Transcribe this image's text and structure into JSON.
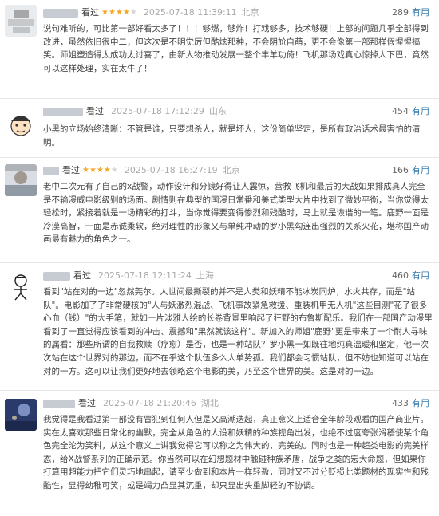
{
  "comments": [
    {
      "action": "看过",
      "rating": 4,
      "time": "2025-07-18 11:39:11",
      "location": "北京",
      "votes": "289",
      "useful_label": "有用",
      "content": "说句难听的，可比第一部好看太多了！！！够燃，够炸！打戏够多，技术够硬！上部的问题几乎全部得到改进，虽然依旧很中二，但这次是不明觉厉但酷炫那种，不会阴尬自萌，更不会像第一部那样假惺惺搞笑。师姐塑造得太成功太讨喜了，由新人物推动发展一整个丰羊功倚！飞机那场戏真心惊掉人下巴，竟然可以这样处理，实在太牛了！"
    },
    {
      "action": "看过",
      "rating": 0,
      "time": "2025-07-18 17:12:29",
      "location": "山东",
      "votes": "454",
      "useful_label": "有用",
      "content": "小黑的立场始终清晰：不管是谁，只要想杀人，就是坏人，这份简单坚定，是所有政治话术最害怕的清明。"
    },
    {
      "action": "看过",
      "rating": 4,
      "time": "2025-07-18 16:27:19",
      "location": "北京",
      "votes": "166",
      "useful_label": "有用",
      "content": "老中二次元有了自己的x战警，动作设计和分镜好得让人震惊，营救飞机和最后的大战如果排成真人完全是不输漫威电影级别的场面。剧情则在典型的国漫日常番和美式类型大片中找到了微妙平衡，当你觉得太轻松时，紧接着就是一场精彩的打斗，当你觉得要变得惨烈和残酷时，马上就是诙谐的一笔。鹿野一面是冷漠高智，一面是赤诚柔软，绝对理性的形象又与单纯冲动的罗小黑勾连出强烈的关系火花，堪称国产动画最有魅力的角色之一。"
    },
    {
      "action": "看过",
      "rating": 0,
      "time": "2025-07-18 12:11:24",
      "location": "上海",
      "votes": "460",
      "useful_label": "有用",
      "content": "看到\"站在对的一边\"忽然莞尔。人世间最撕裂的并不是人类和妖精不能冰炭同炉，水火共存，而是\"站队\"。电影加了了非常硬核的\"人与妖激烈混战、飞机事故紧急救援、重装机甲无人机\"这些目测\"花了很多心血（钱）\"的大手笔，就如一片淡雅人绘的长卷背景里响起了狂野的布鲁斯配乐。我们在一部国产动漫里看到了一直觉得应该看到的冲击、震撼和\"果然就该这样\"。新加入的师姐\"鹿野\"更是带来了一个耐人寻味的属看：那些所谓的自我救赎（疗愈）是否，也是一种站队？罗小黑一如既往地纯真温暖和坚定，他一次次站在这个世界对的那边，而不在乎这个队伍多么人单势孤。我们都会习惯站队，但不妨也知道可以站在对的一方。这可以让我们更好地去领略这个电影的美，乃至这个世界的美。这是对的一边。"
    },
    {
      "action": "看过",
      "rating": 0,
      "time": "2025-07-18 21:20:46",
      "location": "湖北",
      "votes": "433",
      "useful_label": "有用",
      "content": "我觉得是我看过第一部没有冒犯到任何人但是又高潮迭起，真正意义上适合全年龄段观看的国产商业片。实在太喜欢那些日常化的幽默，完全从角色的人设和妖精的种族视角出发，也绝不过度夸张滑稽使某个角色完全沦为笑料，从这个意义上讲我觉得它可以称之为伟大的，完美的。同时也是一种超类电影的完美样态，给X战警系列的正确示范。你当然可以在幻想题材中触碰种族矛盾，战争之类的宏大命题，但如果你打算用超能力把它们灵巧地串起，请至少做到和本片一样轻盈，同时又不过分贬损此类题材的现实性和残酷性，显得幼稚可笑，或是竭力凸显其沉重，却只显出头重脚轻的不协调。"
    }
  ]
}
